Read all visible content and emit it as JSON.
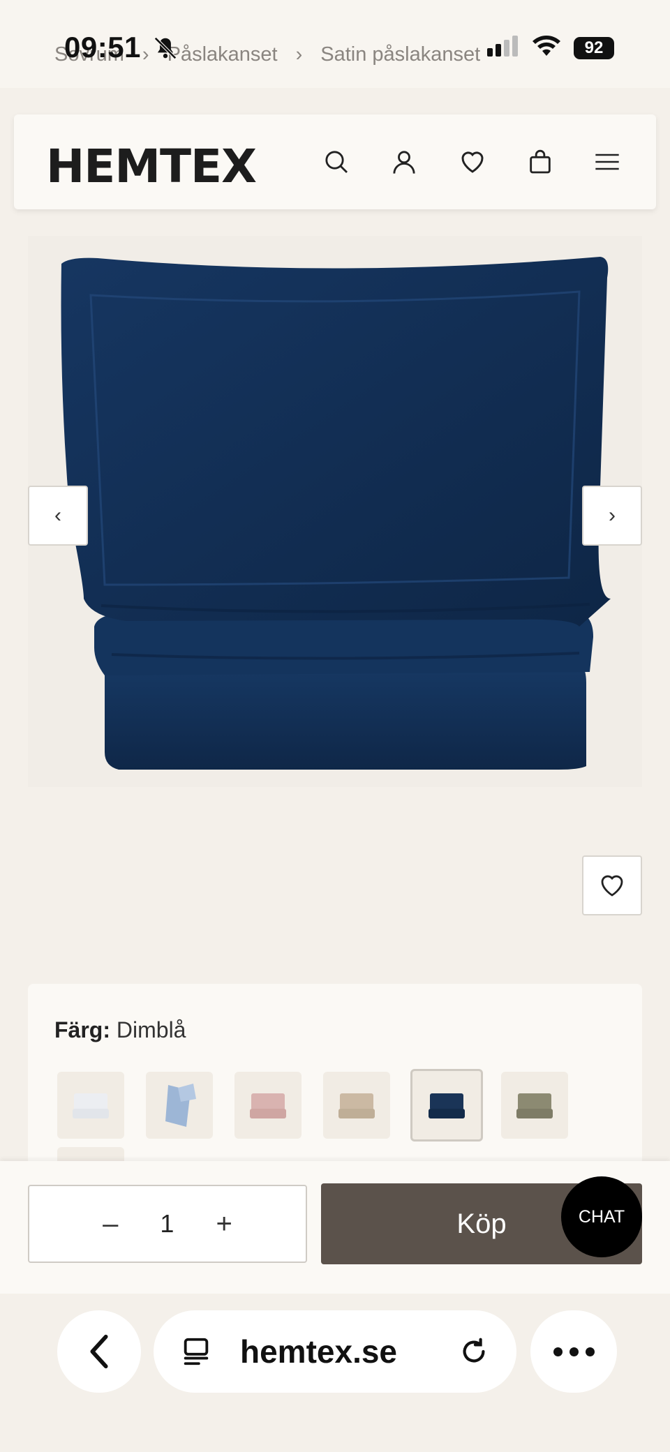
{
  "status_bar": {
    "time": "09:51",
    "battery": "92"
  },
  "breadcrumb": {
    "items": [
      "Sovrum",
      "Påslakanset",
      "Satin påslakanset"
    ],
    "separator": "›"
  },
  "header": {
    "logo": "HEMTEX",
    "icons": [
      "search-icon",
      "user-icon",
      "heart-icon",
      "bag-icon",
      "menu-icon"
    ]
  },
  "gallery": {
    "prev_label": "‹",
    "next_label": "›",
    "product_color": "#123056"
  },
  "color_selector": {
    "label": "Färg:",
    "value": "Dimblå",
    "swatches": [
      {
        "name": "white",
        "color": "#eceef2"
      },
      {
        "name": "light-blue-pattern",
        "color": "#9db6d6"
      },
      {
        "name": "pink",
        "color": "#d9b3b0"
      },
      {
        "name": "beige",
        "color": "#cbb9a3"
      },
      {
        "name": "navy",
        "color": "#1a3457",
        "selected": true
      },
      {
        "name": "olive",
        "color": "#8c8a72"
      }
    ]
  },
  "buy_bar": {
    "quantity": "1",
    "minus": "–",
    "plus": "+",
    "buy_label": "Köp",
    "chat_label": "CHAT"
  },
  "browser": {
    "url": "hemtex.se"
  }
}
